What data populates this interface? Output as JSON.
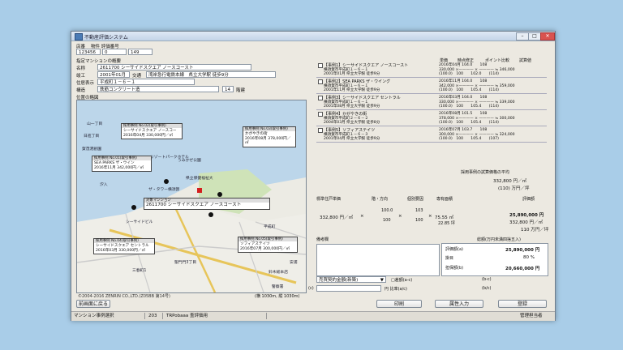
{
  "window": {
    "title": "不動産評価システム",
    "min": "–",
    "max": "□",
    "close": "✕"
  },
  "header": {
    "col_store": "店番",
    "col_case_no": "物件 評価番号",
    "store": "123456",
    "code1": "0",
    "code2": "149",
    "section_title": "指定マンションの概要",
    "name_label": "名称",
    "name_value": "2611700 シーサイドスクエア ノースコースト",
    "built_label": "竣工",
    "built_value": "2001年01月",
    "transport_label": "交通",
    "transport_value": "湾岸急行電鉄本線　県立大学駅 徒歩9分",
    "address_label": "住居表示",
    "address_value": "平成町１－６－１",
    "structure_label": "構造",
    "structure_value": "鉄筋コンクリート造",
    "floors_value": "14",
    "floors_label": "階建"
  },
  "map": {
    "title": "位置の略図",
    "places": [
      "山一丁目",
      "賀茂港創園",
      "日進丁目",
      "うみかぜ公園",
      "リゾートパークホテル",
      "県立保健福祉大",
      "ザ・タワー横須賀",
      "シーサイドビル",
      "汐入",
      "三春町1",
      "安浦",
      "鈴木総本店",
      "警察署",
      "平成町",
      "聖門門3丁目"
    ],
    "callouts": [
      {
        "head": "採用事例 No.02(取引事例)",
        "l1": "シーサイドスクエア ノースコー",
        "l2": "2016年04月 330,000円／㎡"
      },
      {
        "head": "採用事例 No.03(取引事例)",
        "l1": "かがやきの街",
        "l2": "2016年08月 378,000円／㎡"
      },
      {
        "head": "採用事例 No.01(取引事例)",
        "l1": "SEA PARKS ザ・ウイン",
        "l2": "2016年11月 342,000円／㎡"
      },
      {
        "head": "対象マンション",
        "l1": "2611700 シーサイドスクエア ノースコースト",
        "l2": ""
      },
      {
        "head": "採用事例 No.04(取引事例)",
        "l1": "シーサイドスクエア セントラル",
        "l2": "2016年03月 330,000円／㎡"
      },
      {
        "head": "採用事例 No.05(取引事例)",
        "l1": "ソフィアステイツ",
        "l2": "2016年07月 300,000円／㎡"
      }
    ],
    "footer_left": "©2004-2016 ZENRIN CO.,LTD.(Z05BB 第14号)",
    "footer_right": "(横 1030m, 縦 1030m)"
  },
  "cases_header": {
    "col1": "単価",
    "col2": "時点修正",
    "col3": "ポイント比較",
    "col4": "試算値"
  },
  "cases": [
    {
      "title": "【事例1】シーサイドスクエア ノースコースト",
      "addr": "横須賀市平成町１－６－１",
      "date": "2001年01月 県立大学駅 徒歩9分",
      "r1": "2016年04月 104.0　　108",
      "r2": "330,000 ×———— × ———— ≒ 346,000",
      "r3": "(100.0)　100　　102.0　　(114)"
    },
    {
      "title": "【事例2】SEA PARKS ザ・ウイング",
      "addr": "横須賀市平成町１－６－１",
      "date": "2001年11月 県立大学駅 徒歩9分",
      "r1": "2016年11月 104.0　　108",
      "r2": "342,000 ×———— × ———— ≒ 359,000",
      "r3": "(100.0)　100　　105.4　　(114)"
    },
    {
      "title": "【事例3】シーサイドスクエア セントラル",
      "addr": "横須賀市平成町１－６－１",
      "date": "2001年08月 県立大学駅 徒歩9分",
      "r1": "2016年03月 104.0　　108",
      "r2": "330,000 ×———— × ———— ≒ 339,000",
      "r3": "(100.0)　100　　105.4　　(114)"
    },
    {
      "title": "【事例4】かがやきの街",
      "addr": "横須賀市平成町２－６－２",
      "date": "2004年03月 県立大学駅 徒歩8分",
      "r1": "2016年08月 101.5　　108",
      "r2": "378,000 ×———— × ———— ≒ 300,000",
      "r3": "(100.0)　100　　105.4　　(114)"
    },
    {
      "title": "【事例5】ソフィアステイツ",
      "addr": "横須賀市平成町１－６－３",
      "date": "2001年04月 県立大学駅 徒歩9分",
      "r1": "2016年07月 103.7　　108",
      "r2": "300,000 ×———— × ———— ≒ 324,000",
      "r3": "(100.0)　100　　105.4　　(107)"
    }
  ],
  "average": {
    "label": "採用事例の試算価格の平均",
    "value": "332,800 円／㎡",
    "sub": "(110) 万円／坪"
  },
  "standard": {
    "h1": "標準住戸単価",
    "h2": "階・方向",
    "h3": "個別要因",
    "h4": "専有面積",
    "h5": "評価額",
    "unit_price": "332,800 円／㎡",
    "f1": "100.0",
    "f1d": "100",
    "f2": "103",
    "f2d": "100",
    "area": "75.55 ㎡",
    "area_tsubo": "22.85 坪",
    "eval1": "25,890,000 円",
    "eval2": "332,800 円／㎡",
    "eval3": "110 万円／坪"
  },
  "remarks": {
    "label": "備考欄"
  },
  "summary": {
    "title": "総額(万円未満四捨五入)",
    "eval_label": "評価額(a)",
    "eval_value": "25,890,000 円",
    "ratio_label": "掛目",
    "ratio_value": "80 %",
    "collateral_label": "担保額(b)",
    "collateral_value": "20,660,000 円"
  },
  "footer": {
    "select_value": "売買契約金額(新築)",
    "select_arrow": "▼",
    "c_label": "(c)",
    "unit_yen": "円",
    "ratio_ac": "円 比率(a/c)",
    "diff_label": "□差額(a-c)",
    "diff_expr": "(b-c)",
    "ratio_bc": "(b/c)"
  },
  "buttons": {
    "back": "前画面に戻る",
    "print": "印刷",
    "attr": "属性入力",
    "save": "登録"
  },
  "statusbar": {
    "s1": "マンション事例選択",
    "s2": "203",
    "s3": "TRPobaaa 査評価用",
    "s4": "管理担当者"
  }
}
